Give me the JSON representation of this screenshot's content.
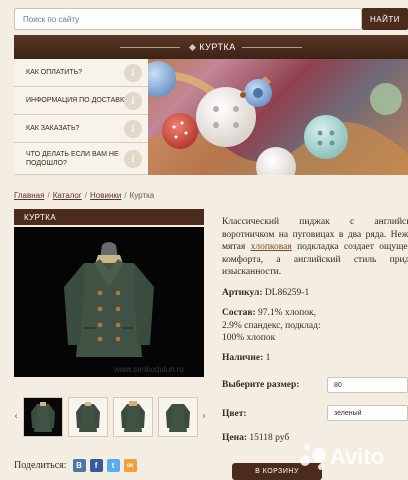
{
  "search": {
    "placeholder": "Поиск по сайту",
    "button": "НАЙТИ"
  },
  "banner": {
    "title": "КУРТКА"
  },
  "faq": {
    "items": [
      {
        "label": "КАК ОПЛАТИТЬ?"
      },
      {
        "label": "ИНФОРМАЦИЯ ПО ДОСТАВКЕ"
      },
      {
        "label": "КАК ЗАКАЗАТЬ?"
      },
      {
        "label": "ЧТО ДЕЛАТЬ ЕСЛИ ВАМ НЕ ПОДОШЛО?"
      }
    ],
    "icon_glyph": "i"
  },
  "breadcrumb": [
    "Главная",
    "Каталог",
    "Новинки",
    "Куртка"
  ],
  "product": {
    "title": "КУРТКА",
    "watermark": "www.senbodulun.ru",
    "description_part1": "Классический пиджак с английским воротничком на пуговицах в два ряда. Нежная мятая ",
    "description_link": "хлопковая",
    "description_part2": " подкладка создает ощущение комфорта, а английский стиль придает изысканности.",
    "article_label": "Артикул:",
    "article_value": "DL86259-1",
    "composition_label": "Состав:",
    "composition_line1": "97.1% хлопок,",
    "composition_line2": "2.9% спандекс, подклад:",
    "composition_line3": "100% хлопок",
    "stock_label": "Наличие:",
    "stock_value": "1",
    "size_label": "Выберите размер:",
    "size_value": "80",
    "color_label": "Цвет:",
    "color_value": "зеленый",
    "price_label": "Цена:",
    "price_value": "15118 руб",
    "cart_button": "В КОРЗИНУ"
  },
  "share": {
    "label": "Поделиться:",
    "networks": [
      {
        "name": "vk",
        "glyph": "В",
        "color": "#4a76a8"
      },
      {
        "name": "facebook",
        "glyph": "f",
        "color": "#3b5998"
      },
      {
        "name": "twitter",
        "glyph": "t",
        "color": "#55acee"
      },
      {
        "name": "odnoklassniki",
        "glyph": "ок",
        "color": "#f2a03d"
      }
    ]
  },
  "watermark_brand": "Avito",
  "colors": {
    "brown": "#4b2c1c",
    "coat_green": "#3f5244"
  }
}
